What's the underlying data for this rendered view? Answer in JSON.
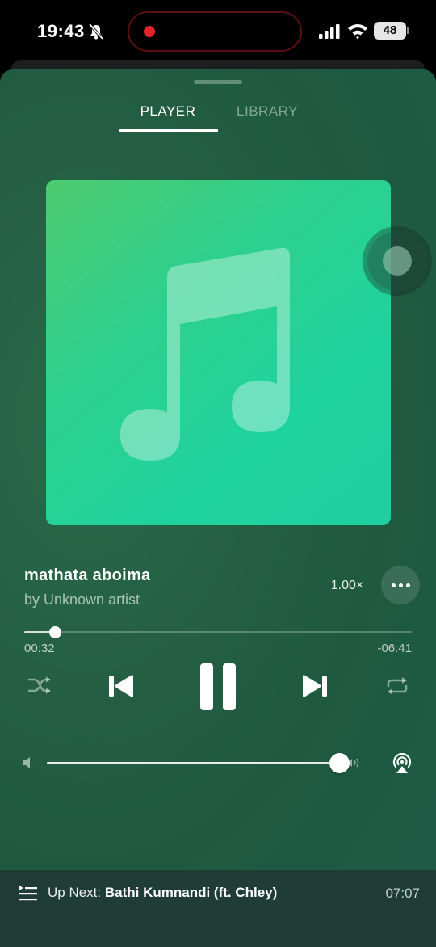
{
  "status_bar": {
    "time": "19:43",
    "battery": "48"
  },
  "tabs": [
    {
      "label": "PLAYER",
      "active": true
    },
    {
      "label": "LIBRARY",
      "active": false
    }
  ],
  "track": {
    "title": "mathata aboima",
    "artist": "by Unknown artist"
  },
  "playback": {
    "speed": "1.00×",
    "elapsed": "00:32",
    "remaining": "-06:41",
    "progress_fraction": 0.08,
    "state": "playing"
  },
  "volume": {
    "level_fraction": 0.997
  },
  "up_next": {
    "prefix": "Up Next: ",
    "title": "Bathi Kumnandi (ft. Chley)",
    "duration": "07:07"
  },
  "icons": {
    "status": [
      "bell-slash-icon",
      "cellular-signal-icon",
      "wifi-icon",
      "battery-icon"
    ],
    "controls": [
      "shuffle-icon",
      "previous-track-icon",
      "pause-icon",
      "next-track-icon",
      "repeat-icon"
    ],
    "other": [
      "more-icon",
      "volume-low-icon",
      "volume-high-icon",
      "airplay-icon",
      "queue-list-icon",
      "music-note-icon"
    ]
  },
  "colors": {
    "recording_dot": "#e0242a",
    "artwork_start": "#4ecb6f",
    "artwork_end": "#1fcf9f"
  }
}
